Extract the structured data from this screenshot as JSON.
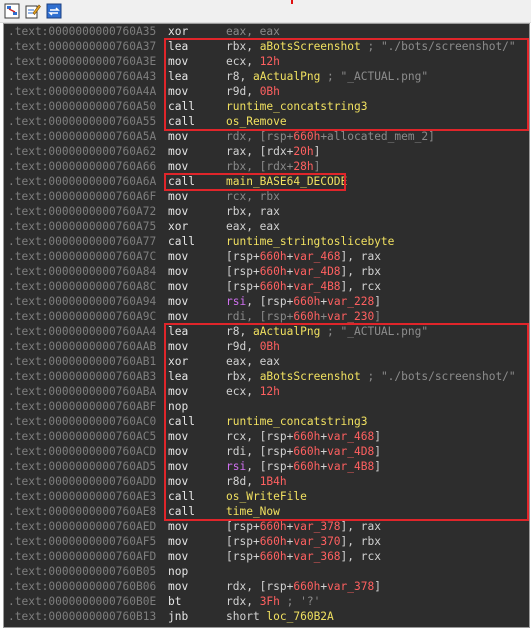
{
  "toolbar": {
    "icons": [
      "graph-view-icon",
      "edit-icon",
      "sync-icon"
    ]
  },
  "listing": {
    "rows": [
      {
        "addr": ".text:0000000000760A35",
        "mnem": "xor",
        "ops": [
          {
            "t": "eax, eax",
            "c": "dim"
          }
        ]
      },
      {
        "addr": ".text:0000000000760A37",
        "mnem": "lea",
        "ops": [
          {
            "t": "rbx, ",
            "c": "reg"
          },
          {
            "t": "aBotsScreenshot",
            "c": "sym"
          },
          {
            "t": " ; \"./bots/screenshot/\"",
            "c": "cmt"
          }
        ]
      },
      {
        "addr": ".text:0000000000760A3E",
        "mnem": "mov",
        "ops": [
          {
            "t": "ecx, ",
            "c": "reg"
          },
          {
            "t": "12h",
            "c": "num"
          }
        ]
      },
      {
        "addr": ".text:0000000000760A43",
        "mnem": "lea",
        "ops": [
          {
            "t": "r8, ",
            "c": "reg"
          },
          {
            "t": "aActualPng",
            "c": "sym"
          },
          {
            "t": "  ; \"_ACTUAL.png\"",
            "c": "cmt"
          }
        ]
      },
      {
        "addr": ".text:0000000000760A4A",
        "mnem": "mov",
        "ops": [
          {
            "t": "r9d, ",
            "c": "reg"
          },
          {
            "t": "0Bh",
            "c": "num"
          }
        ]
      },
      {
        "addr": ".text:0000000000760A50",
        "mnem": "call",
        "ops": [
          {
            "t": "runtime_concatstring3",
            "c": "sym"
          }
        ]
      },
      {
        "addr": ".text:0000000000760A55",
        "mnem": "call",
        "ops": [
          {
            "t": "os_Remove",
            "c": "sym"
          }
        ]
      },
      {
        "addr": ".text:0000000000760A5A",
        "mnem": "mov",
        "ops": [
          {
            "t": "rdx, [rsp+",
            "c": "dim"
          },
          {
            "t": "660h",
            "c": "num"
          },
          {
            "t": "+allocated_mem_2]",
            "c": "dim"
          }
        ]
      },
      {
        "addr": ".text:0000000000760A62",
        "mnem": "mov",
        "ops": [
          {
            "t": "rax, [rdx+",
            "c": "reg"
          },
          {
            "t": "20h",
            "c": "num"
          },
          {
            "t": "]",
            "c": "reg"
          }
        ]
      },
      {
        "addr": ".text:0000000000760A66",
        "mnem": "mov",
        "ops": [
          {
            "t": "rbx, [rdx+",
            "c": "dim"
          },
          {
            "t": "28h",
            "c": "num"
          },
          {
            "t": "]",
            "c": "dim"
          }
        ]
      },
      {
        "addr": ".text:0000000000760A6A",
        "mnem": "call",
        "ops": [
          {
            "t": "main_BASE64_DECODE",
            "c": "sym"
          }
        ]
      },
      {
        "addr": ".text:0000000000760A6F",
        "mnem": "mov",
        "ops": [
          {
            "t": "rcx, rbx",
            "c": "dim"
          }
        ]
      },
      {
        "addr": ".text:0000000000760A72",
        "mnem": "mov",
        "ops": [
          {
            "t": "rbx, rax",
            "c": "reg"
          }
        ]
      },
      {
        "addr": ".text:0000000000760A75",
        "mnem": "xor",
        "ops": [
          {
            "t": "eax, eax",
            "c": "reg"
          }
        ]
      },
      {
        "addr": ".text:0000000000760A77",
        "mnem": "call",
        "ops": [
          {
            "t": "runtime_stringtoslicebyte",
            "c": "sym"
          }
        ]
      },
      {
        "addr": ".text:0000000000760A7C",
        "mnem": "mov",
        "ops": [
          {
            "t": "[rsp+",
            "c": "reg"
          },
          {
            "t": "660h",
            "c": "num"
          },
          {
            "t": "+",
            "c": "reg"
          },
          {
            "t": "var_468",
            "c": "var"
          },
          {
            "t": "], rax",
            "c": "reg"
          }
        ]
      },
      {
        "addr": ".text:0000000000760A84",
        "mnem": "mov",
        "ops": [
          {
            "t": "[rsp+",
            "c": "reg"
          },
          {
            "t": "660h",
            "c": "num"
          },
          {
            "t": "+",
            "c": "reg"
          },
          {
            "t": "var_4D8",
            "c": "var"
          },
          {
            "t": "], rbx",
            "c": "reg"
          }
        ]
      },
      {
        "addr": ".text:0000000000760A8C",
        "mnem": "mov",
        "ops": [
          {
            "t": "[rsp+",
            "c": "reg"
          },
          {
            "t": "660h",
            "c": "num"
          },
          {
            "t": "+",
            "c": "reg"
          },
          {
            "t": "var_4B8",
            "c": "var"
          },
          {
            "t": "], rcx",
            "c": "reg"
          }
        ]
      },
      {
        "addr": ".text:0000000000760A94",
        "mnem": "mov",
        "ops": [
          {
            "t": "rsi",
            "c": "regp"
          },
          {
            "t": ", [rsp+",
            "c": "reg"
          },
          {
            "t": "660h",
            "c": "num"
          },
          {
            "t": "+",
            "c": "reg"
          },
          {
            "t": "var_228",
            "c": "var"
          },
          {
            "t": "]",
            "c": "reg"
          }
        ]
      },
      {
        "addr": ".text:0000000000760A9C",
        "mnem": "mov",
        "ops": [
          {
            "t": "rdi, [rsp+",
            "c": "dim"
          },
          {
            "t": "660h",
            "c": "num"
          },
          {
            "t": "+",
            "c": "dim"
          },
          {
            "t": "var_230",
            "c": "var"
          },
          {
            "t": "]",
            "c": "dim"
          }
        ]
      },
      {
        "addr": ".text:0000000000760AA4",
        "mnem": "lea",
        "ops": [
          {
            "t": "r8, ",
            "c": "reg"
          },
          {
            "t": "aActualPng",
            "c": "sym"
          },
          {
            "t": "  ; \"_ACTUAL.png\"",
            "c": "cmt"
          }
        ]
      },
      {
        "addr": ".text:0000000000760AAB",
        "mnem": "mov",
        "ops": [
          {
            "t": "r9d, ",
            "c": "reg"
          },
          {
            "t": "0Bh",
            "c": "num"
          }
        ]
      },
      {
        "addr": ".text:0000000000760AB1",
        "mnem": "xor",
        "ops": [
          {
            "t": "eax, eax",
            "c": "reg"
          }
        ]
      },
      {
        "addr": ".text:0000000000760AB3",
        "mnem": "lea",
        "ops": [
          {
            "t": "rbx, ",
            "c": "reg"
          },
          {
            "t": "aBotsScreenshot",
            "c": "sym"
          },
          {
            "t": " ; \"./bots/screenshot/\"",
            "c": "cmt"
          }
        ]
      },
      {
        "addr": ".text:0000000000760ABA",
        "mnem": "mov",
        "ops": [
          {
            "t": "ecx, ",
            "c": "reg"
          },
          {
            "t": "12h",
            "c": "num"
          }
        ]
      },
      {
        "addr": ".text:0000000000760ABF",
        "mnem": "nop",
        "ops": []
      },
      {
        "addr": ".text:0000000000760AC0",
        "mnem": "call",
        "ops": [
          {
            "t": "runtime_concatstring3",
            "c": "sym"
          }
        ]
      },
      {
        "addr": ".text:0000000000760AC5",
        "mnem": "mov",
        "ops": [
          {
            "t": "rcx, [rsp+",
            "c": "reg"
          },
          {
            "t": "660h",
            "c": "num"
          },
          {
            "t": "+",
            "c": "reg"
          },
          {
            "t": "var_468",
            "c": "var"
          },
          {
            "t": "]",
            "c": "reg"
          }
        ]
      },
      {
        "addr": ".text:0000000000760ACD",
        "mnem": "mov",
        "ops": [
          {
            "t": "rdi, [rsp+",
            "c": "reg"
          },
          {
            "t": "660h",
            "c": "num"
          },
          {
            "t": "+",
            "c": "reg"
          },
          {
            "t": "var_4D8",
            "c": "var"
          },
          {
            "t": "]",
            "c": "reg"
          }
        ]
      },
      {
        "addr": ".text:0000000000760AD5",
        "mnem": "mov",
        "ops": [
          {
            "t": "rsi",
            "c": "regp"
          },
          {
            "t": ", [rsp+",
            "c": "reg"
          },
          {
            "t": "660h",
            "c": "num"
          },
          {
            "t": "+",
            "c": "reg"
          },
          {
            "t": "var_4B8",
            "c": "var"
          },
          {
            "t": "]",
            "c": "reg"
          }
        ]
      },
      {
        "addr": ".text:0000000000760ADD",
        "mnem": "mov",
        "ops": [
          {
            "t": "r8d, ",
            "c": "reg"
          },
          {
            "t": "1B4h",
            "c": "num"
          }
        ]
      },
      {
        "addr": ".text:0000000000760AE3",
        "mnem": "call",
        "ops": [
          {
            "t": "os_WriteFile",
            "c": "sym"
          }
        ]
      },
      {
        "addr": ".text:0000000000760AE8",
        "mnem": "call",
        "ops": [
          {
            "t": "time_Now",
            "c": "sym"
          }
        ]
      },
      {
        "addr": ".text:0000000000760AED",
        "mnem": "mov",
        "ops": [
          {
            "t": "[rsp+",
            "c": "reg"
          },
          {
            "t": "660h",
            "c": "num"
          },
          {
            "t": "+",
            "c": "reg"
          },
          {
            "t": "var_378",
            "c": "var"
          },
          {
            "t": "], rax",
            "c": "reg"
          }
        ]
      },
      {
        "addr": ".text:0000000000760AF5",
        "mnem": "mov",
        "ops": [
          {
            "t": "[rsp+",
            "c": "reg"
          },
          {
            "t": "660h",
            "c": "num"
          },
          {
            "t": "+",
            "c": "reg"
          },
          {
            "t": "var_370",
            "c": "var"
          },
          {
            "t": "], rbx",
            "c": "reg"
          }
        ]
      },
      {
        "addr": ".text:0000000000760AFD",
        "mnem": "mov",
        "ops": [
          {
            "t": "[rsp+",
            "c": "reg"
          },
          {
            "t": "660h",
            "c": "num"
          },
          {
            "t": "+",
            "c": "reg"
          },
          {
            "t": "var_368",
            "c": "var"
          },
          {
            "t": "], rcx",
            "c": "reg"
          }
        ]
      },
      {
        "addr": ".text:0000000000760B05",
        "mnem": "nop",
        "ops": []
      },
      {
        "addr": ".text:0000000000760B06",
        "mnem": "mov",
        "ops": [
          {
            "t": "rdx, [rsp+",
            "c": "reg"
          },
          {
            "t": "660h",
            "c": "num"
          },
          {
            "t": "+",
            "c": "reg"
          },
          {
            "t": "var_378",
            "c": "var"
          },
          {
            "t": "]",
            "c": "reg"
          }
        ]
      },
      {
        "addr": ".text:0000000000760B0E",
        "mnem": "bt",
        "ops": [
          {
            "t": "rdx, ",
            "c": "reg"
          },
          {
            "t": "3Fh",
            "c": "num"
          },
          {
            "t": " ; '?'",
            "c": "cmt"
          }
        ]
      },
      {
        "addr": ".text:0000000000760B13",
        "mnem": "jnb",
        "ops": [
          {
            "t": "short ",
            "c": "reg"
          },
          {
            "t": "loc_760B2A",
            "c": "sym"
          }
        ]
      }
    ]
  },
  "highlights": [
    {
      "name": "highlight-box-remove-screenshot",
      "first_row": 1,
      "last_row": 6
    },
    {
      "name": "highlight-box-base64-decode",
      "first_row": 10,
      "last_row": 10
    },
    {
      "name": "highlight-box-write-screenshot",
      "first_row": 20,
      "last_row": 32
    }
  ],
  "colors": {
    "background": "#2d2d2d",
    "address": "#7e7e7e",
    "mnemonic": "#e6e6e6",
    "symbol": "#f0e060",
    "number": "#ff6060",
    "register_purple": "#d070f0",
    "highlight": "#e0252a"
  }
}
